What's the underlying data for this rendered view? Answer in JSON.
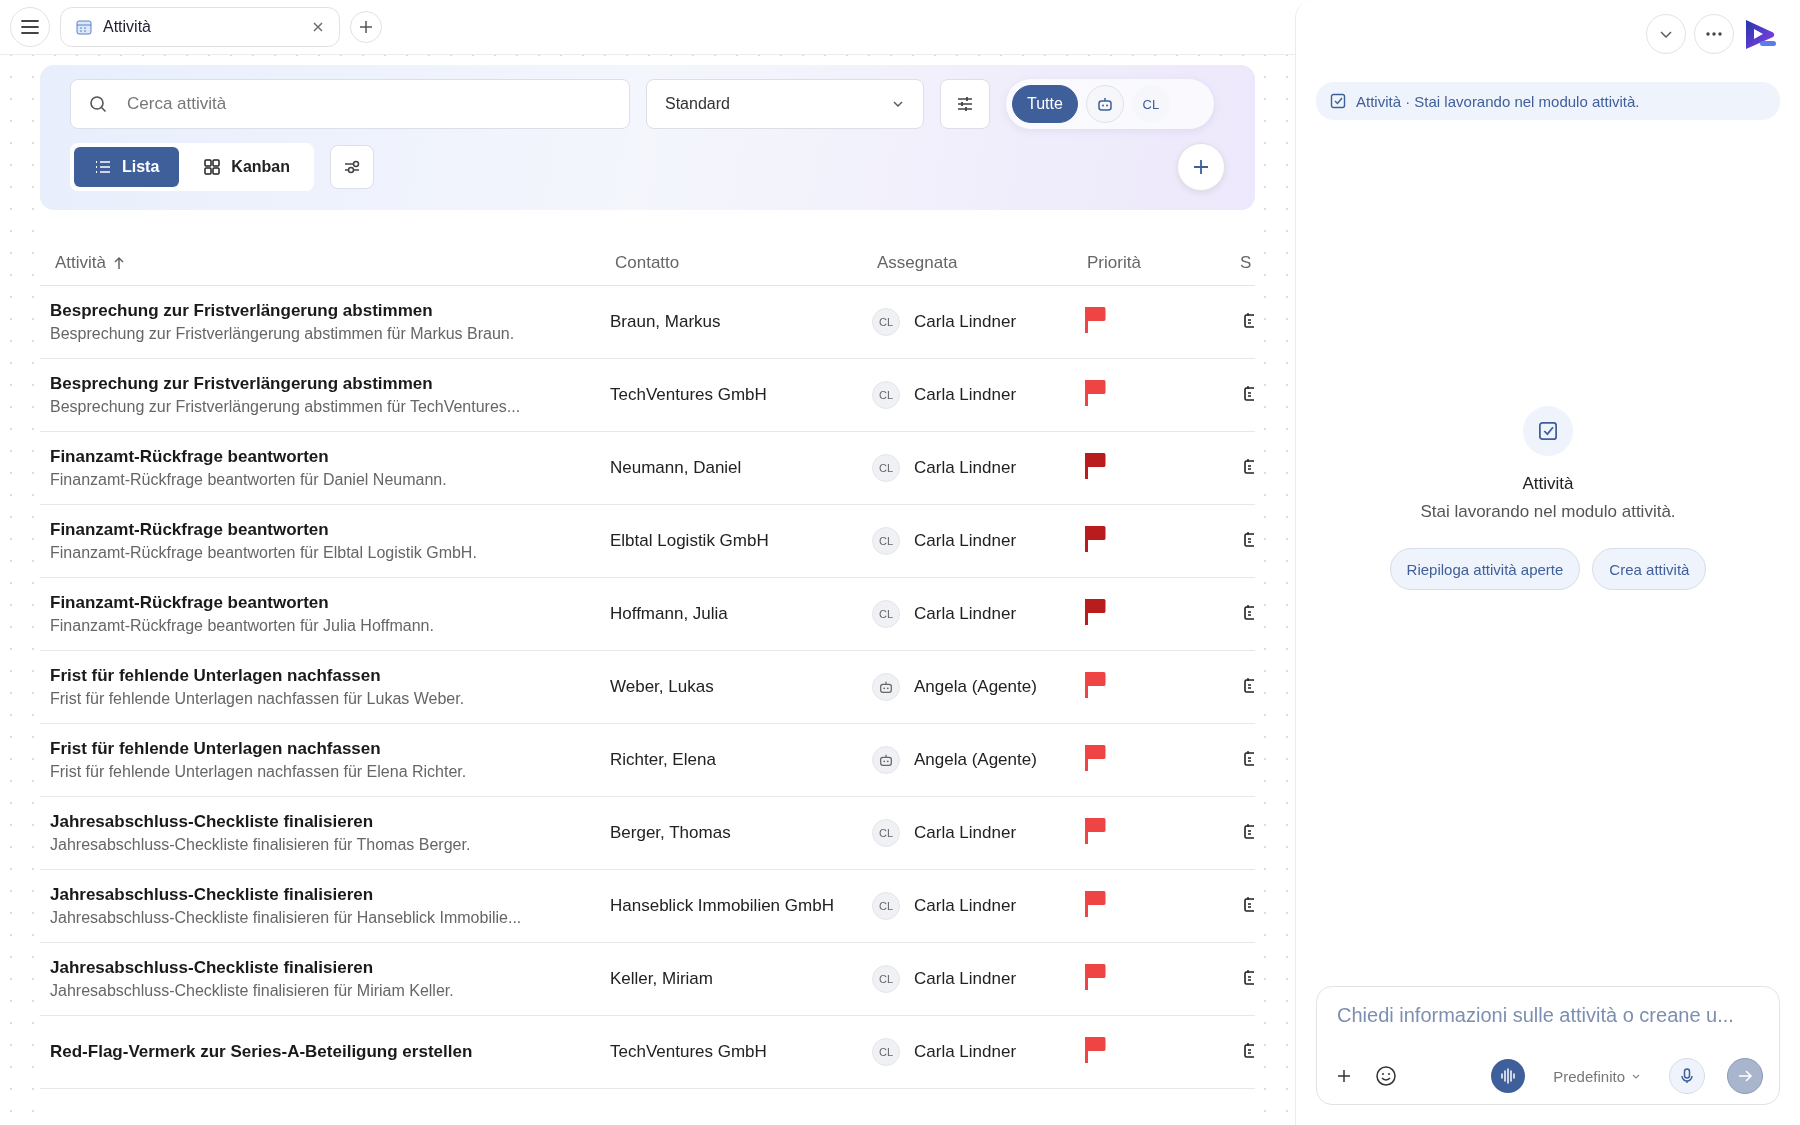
{
  "tab_bar": {
    "tab": {
      "label": "Attività"
    }
  },
  "toolbar": {
    "search": {
      "placeholder": "Cerca attività"
    },
    "view_select": {
      "value": "Standard"
    },
    "filter_chips": [
      {
        "kind": "text",
        "label": "Tutte",
        "selected": true
      },
      {
        "kind": "robot",
        "selected": false
      },
      {
        "kind": "text",
        "label": "CL",
        "selected": false
      }
    ],
    "view_toggle": [
      {
        "kind": "list",
        "label": "Lista",
        "selected": true
      },
      {
        "kind": "grid",
        "label": "Kanban",
        "selected": false
      }
    ]
  },
  "table": {
    "columns": [
      "Attività",
      "Contatto",
      "Assegnata",
      "Priorità",
      "S"
    ],
    "rows": [
      {
        "title": "Besprechung zur Fristverlängerung abstimmen",
        "subtitle": "Besprechung zur Fristverlängerung abstimmen für Markus Braun.",
        "contact": "Braun, Markus",
        "assignee": {
          "kind": "person",
          "initials": "CL",
          "name": "Carla Lindner"
        },
        "color": "#ef4444"
      },
      {
        "title": "Besprechung zur Fristverlängerung abstimmen",
        "subtitle": "Besprechung zur Fristverlängerung abstimmen für TechVentures...",
        "contact": "TechVentures GmbH",
        "assignee": {
          "kind": "person",
          "initials": "CL",
          "name": "Carla Lindner"
        },
        "color": "#ef4444"
      },
      {
        "title": "Finanzamt-Rückfrage beantworten",
        "subtitle": "Finanzamt-Rückfrage beantworten für Daniel Neumann.",
        "contact": "Neumann, Daniel",
        "assignee": {
          "kind": "person",
          "initials": "CL",
          "name": "Carla Lindner"
        },
        "color": "#b91c1c"
      },
      {
        "title": "Finanzamt-Rückfrage beantworten",
        "subtitle": "Finanzamt-Rückfrage beantworten für Elbtal Logistik GmbH.",
        "contact": "Elbtal Logistik GmbH",
        "assignee": {
          "kind": "person",
          "initials": "CL",
          "name": "Carla Lindner"
        },
        "color": "#b91c1c"
      },
      {
        "title": "Finanzamt-Rückfrage beantworten",
        "subtitle": "Finanzamt-Rückfrage beantworten für Julia Hoffmann.",
        "contact": "Hoffmann, Julia",
        "assignee": {
          "kind": "person",
          "initials": "CL",
          "name": "Carla Lindner"
        },
        "color": "#b91c1c"
      },
      {
        "title": "Frist für fehlende Unterlagen nachfassen",
        "subtitle": "Frist für fehlende Unterlagen nachfassen für Lukas Weber.",
        "contact": "Weber, Lukas",
        "assignee": {
          "kind": "agent",
          "name": "Angela (Agente)"
        },
        "color": "#ef4444"
      },
      {
        "title": "Frist für fehlende Unterlagen nachfassen",
        "subtitle": "Frist für fehlende Unterlagen nachfassen für Elena Richter.",
        "contact": "Richter, Elena",
        "assignee": {
          "kind": "agent",
          "name": "Angela (Agente)"
        },
        "color": "#ef4444"
      },
      {
        "title": "Jahresabschluss-Checkliste finalisieren",
        "subtitle": "Jahresabschluss-Checkliste finalisieren für Thomas Berger.",
        "contact": "Berger, Thomas",
        "assignee": {
          "kind": "person",
          "initials": "CL",
          "name": "Carla Lindner"
        },
        "color": "#ef4444"
      },
      {
        "title": "Jahresabschluss-Checkliste finalisieren",
        "subtitle": "Jahresabschluss-Checkliste finalisieren für Hanseblick Immobilie...",
        "contact": "Hanseblick Immobilien GmbH",
        "assignee": {
          "kind": "person",
          "initials": "CL",
          "name": "Carla Lindner"
        },
        "color": "#ef4444"
      },
      {
        "title": "Jahresabschluss-Checkliste finalisieren",
        "subtitle": "Jahresabschluss-Checkliste finalisieren für Miriam Keller.",
        "contact": "Keller, Miriam",
        "assignee": {
          "kind": "person",
          "initials": "CL",
          "name": "Carla Lindner"
        },
        "color": "#ef4444"
      },
      {
        "title": "Red-Flag-Vermerk zur Series-A-Beteiligung erstellen",
        "contact": "TechVentures GmbH",
        "assignee": {
          "kind": "person",
          "initials": "CL",
          "name": "Carla Lindner"
        },
        "color": "#ef4444"
      }
    ]
  },
  "assistant": {
    "context": "Attività · Stai lavorando nel modulo attività.",
    "empty_title": "Attività",
    "empty_text": "Stai lavorando nel modulo attività.",
    "suggestions": [
      "Riepiloga attività aperte",
      "Crea attività"
    ],
    "input": {
      "placeholder": "Chiedi informazioni sulle attività o creane u..."
    },
    "mode": "Predefinito"
  }
}
